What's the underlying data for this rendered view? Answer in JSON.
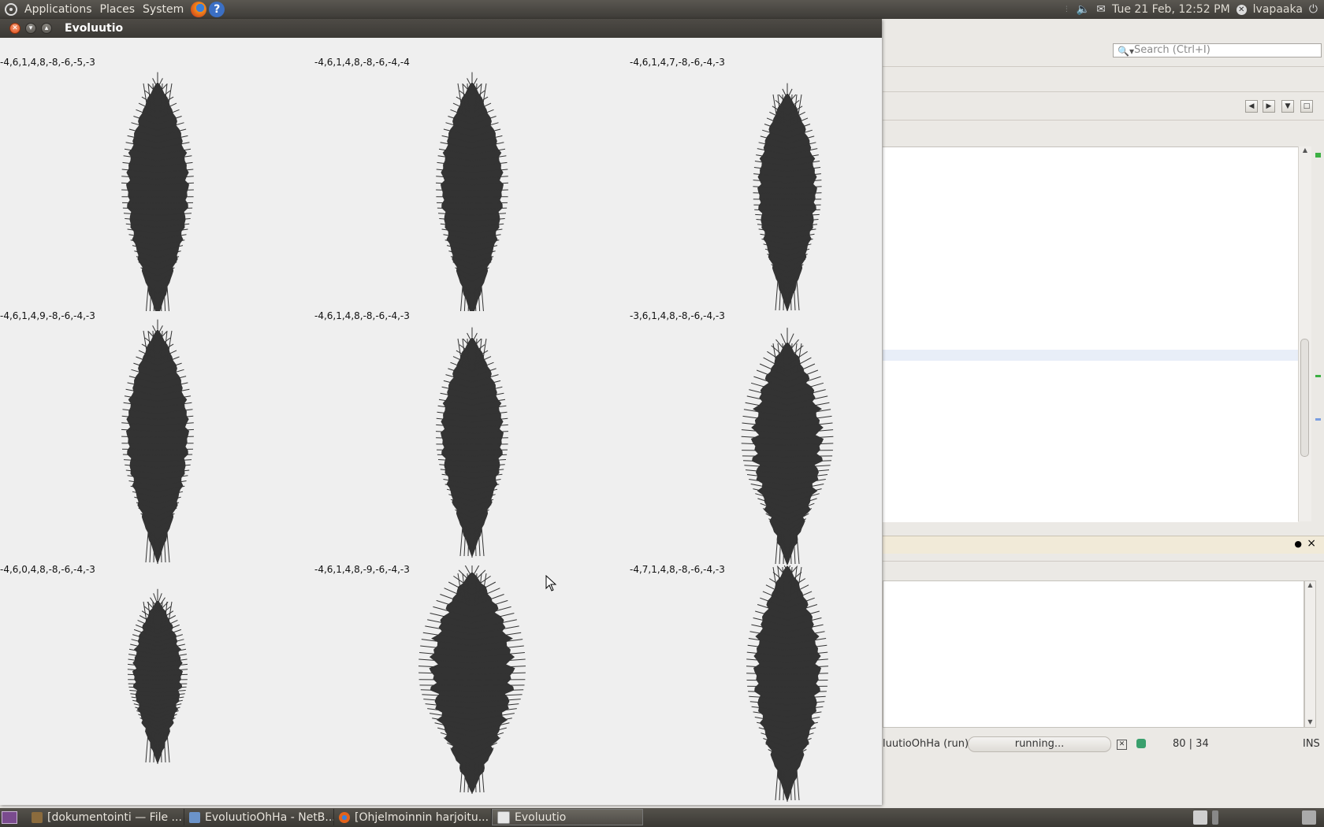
{
  "top_panel": {
    "menus": [
      "Applications",
      "Places",
      "System"
    ],
    "clock": "Tue 21 Feb, 12:52 PM",
    "user": "lvapaaka"
  },
  "evoluutio": {
    "title": "Evoluutio",
    "cells": [
      {
        "label": "-4,6,1,4,8,-8,-6,-5,-3"
      },
      {
        "label": "-4,6,1,4,8,-8,-6,-4,-4"
      },
      {
        "label": "-4,6,1,4,7,-8,-6,-4,-3"
      },
      {
        "label": "-4,6,1,4,9,-8,-6,-4,-3"
      },
      {
        "label": "-4,6,1,4,8,-8,-6,-4,-3"
      },
      {
        "label": "-3,6,1,4,8,-8,-6,-4,-3"
      },
      {
        "label": "-4,6,0,4,8,-8,-6,-4,-3"
      },
      {
        "label": "-4,6,1,4,8,-9,-6,-4,-3"
      },
      {
        "label": "-4,7,1,4,8,-8,-6,-4,-3"
      }
    ],
    "figure_color": "#333333"
  },
  "netbeans": {
    "search_placeholder": "Search (Ctrl+I)",
    "run_label": "luutioOhHa (run)",
    "progress_text": "running...",
    "caret_position": "80 | 34",
    "insert_mode": "INS"
  },
  "taskbar": {
    "tasks": [
      {
        "label": "[dokumentointi — File ..."
      },
      {
        "label": "EvoluutioOhHa - NetB..."
      },
      {
        "label": "[Ohjelmoinnin harjoitu..."
      },
      {
        "label": "Evoluutio"
      }
    ]
  }
}
